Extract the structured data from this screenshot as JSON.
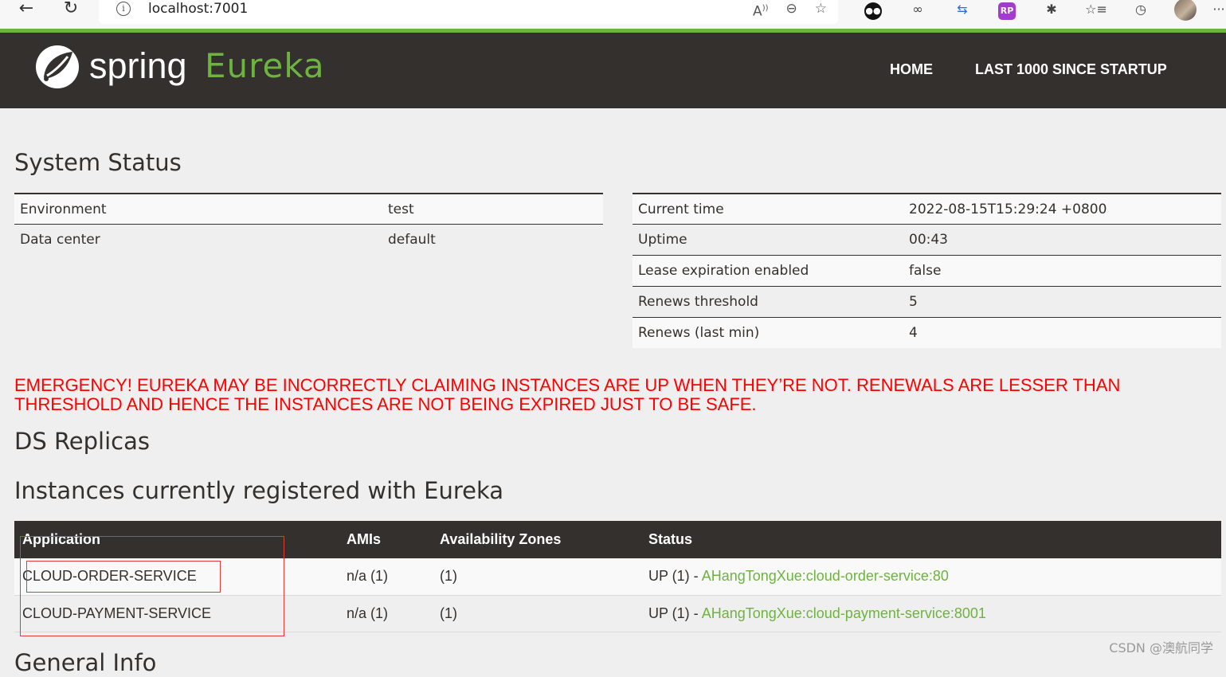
{
  "browser": {
    "url": "localhost:7001",
    "back_icon": "←",
    "reload_icon": "↻",
    "info_icon": "i",
    "read_aloud_icon": "A᭄",
    "zoom_icon": "⊖",
    "favorite_add_icon": "☆",
    "more_icon": "···"
  },
  "nav": {
    "brand_spring": "spring",
    "brand_eureka": "Eureka",
    "home": "HOME",
    "last1000": "LAST 1000 SINCE STARTUP"
  },
  "system_status": {
    "title": "System Status",
    "left": [
      {
        "label": "Environment",
        "value": "test"
      },
      {
        "label": "Data center",
        "value": "default"
      }
    ],
    "right": [
      {
        "label": "Current time",
        "value": "2022-08-15T15:29:24 +0800"
      },
      {
        "label": "Uptime",
        "value": "00:43"
      },
      {
        "label": "Lease expiration enabled",
        "value": "false"
      },
      {
        "label": "Renews threshold",
        "value": "5"
      },
      {
        "label": "Renews (last min)",
        "value": "4"
      }
    ]
  },
  "emergency": "EMERGENCY! EUREKA MAY BE INCORRECTLY CLAIMING INSTANCES ARE UP WHEN THEY’RE NOT. RENEWALS ARE LESSER THAN THRESHOLD AND HENCE THE INSTANCES ARE NOT BEING EXPIRED JUST TO BE SAFE.",
  "ds_replicas": {
    "title": "DS Replicas"
  },
  "instances": {
    "title": "Instances currently registered with Eureka",
    "headers": [
      "Application",
      "AMIs",
      "Availability Zones",
      "Status"
    ],
    "rows": [
      {
        "application": "CLOUD-ORDER-SERVICE",
        "amis": "n/a (1)",
        "zones": "(1)",
        "status_prefix": "UP (1) - ",
        "instance": "AHangTongXue:cloud-order-service:80"
      },
      {
        "application": "CLOUD-PAYMENT-SERVICE",
        "amis": "n/a (1)",
        "zones": "(1)",
        "status_prefix": "UP (1) - ",
        "instance": "AHangTongXue:cloud-payment-service:8001"
      }
    ]
  },
  "general_info": {
    "title": "General Info"
  },
  "watermark": "CSDN @澳航同学",
  "colors": {
    "brand_green": "#6db33f",
    "nav_bg": "#34302d",
    "emergency_red": "#ff0000",
    "annotation_red": "#e03a3a"
  }
}
